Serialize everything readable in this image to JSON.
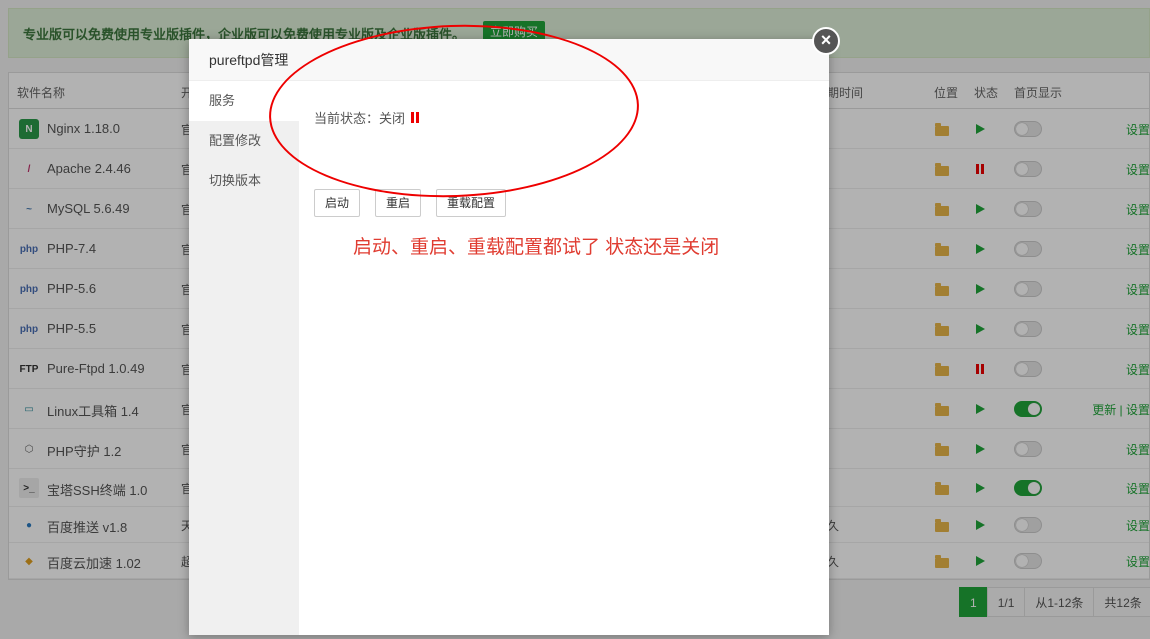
{
  "banner": {
    "text": "专业版可以免费使用专业版插件，企业版可以免费使用专业版及企业版插件。",
    "button": "立即购买"
  },
  "table": {
    "headers": {
      "name": "软件名称",
      "desc": "开",
      "expire": "期时间",
      "location": "位置",
      "status": "状态",
      "home": "首页显示"
    },
    "rows": [
      {
        "name": "Nginx 1.18.0",
        "icon": "nginx-icon",
        "desc": "官",
        "expire": "",
        "status": "running",
        "home": false,
        "action": "设置"
      },
      {
        "name": "Apache 2.4.46",
        "icon": "apache-feather-icon",
        "desc": "官",
        "expire": "",
        "status": "stopped",
        "home": false,
        "action": "设置"
      },
      {
        "name": "MySQL 5.6.49",
        "icon": "mysql-dolphin-icon",
        "desc": "官",
        "expire": "",
        "status": "running",
        "home": false,
        "action": "设置"
      },
      {
        "name": "PHP-7.4",
        "icon": "php-icon",
        "desc": "官",
        "expire": "",
        "status": "running",
        "home": false,
        "action": "设置"
      },
      {
        "name": "PHP-5.6",
        "icon": "php-icon",
        "desc": "官",
        "expire": "",
        "status": "running",
        "home": false,
        "action": "设置"
      },
      {
        "name": "PHP-5.5",
        "icon": "php-icon",
        "desc": "官",
        "expire": "",
        "status": "running",
        "home": false,
        "action": "设置"
      },
      {
        "name": "Pure-Ftpd 1.0.49",
        "icon": "ftp-icon",
        "desc": "官",
        "expire": "",
        "status": "stopped",
        "home": false,
        "action": "设置"
      },
      {
        "name": "Linux工具箱 1.4",
        "icon": "toolbox-icon",
        "desc": "官",
        "expire": "",
        "status": "running",
        "home": true,
        "action": "更新 | 设置"
      },
      {
        "name": "PHP守护 1.2",
        "icon": "php-guard-icon",
        "desc": "官",
        "expire": "",
        "status": "running",
        "home": false,
        "action": "设置"
      },
      {
        "name": "宝塔SSH终端 1.0",
        "icon": "terminal-icon",
        "desc": "官",
        "expire": "",
        "status": "running",
        "home": true,
        "action": "设置"
      },
      {
        "name": "百度推送 v1.8",
        "icon": "baidu-push-icon",
        "desc": "天",
        "expire": "久",
        "status": "running",
        "home": false,
        "action": "设置"
      },
      {
        "name": "百度云加速 1.02",
        "icon": "baidu-cloud-shield-icon",
        "desc": "超",
        "expire": "久",
        "status": "running",
        "home": false,
        "action": "设置"
      }
    ]
  },
  "pager": {
    "current": "1",
    "pages": "1/1",
    "range": "从1-12条",
    "total": "共12条"
  },
  "modal": {
    "title": "pureftpd管理",
    "close": "×",
    "sidebar": [
      "服务",
      "配置修改",
      "切换版本"
    ],
    "status_label": "当前状态：关闭",
    "buttons": {
      "start": "启动",
      "restart": "重启",
      "reload": "重载配置"
    }
  },
  "annotation": "启动、重启、重载配置都试了  状态还是关闭",
  "colors": {
    "accent": "#20a53a",
    "stopped": "#ee0000",
    "annotation": "#e03c31"
  }
}
